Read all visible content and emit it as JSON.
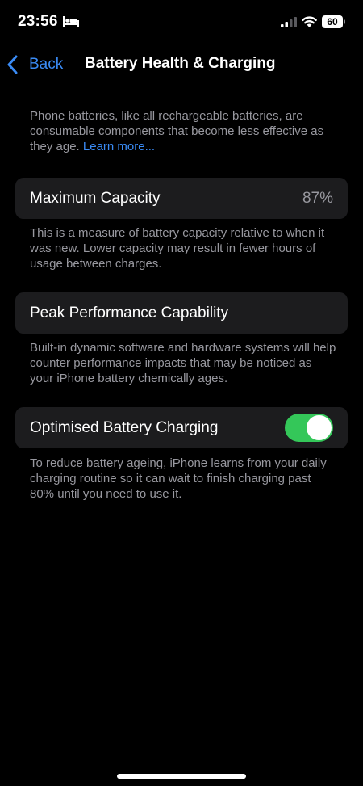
{
  "status_bar": {
    "time": "23:56",
    "sleep_icon": "bed-icon",
    "signal_icon": "cellular-signal-icon",
    "wifi_icon": "wifi-icon",
    "battery_level": "60"
  },
  "nav": {
    "back_label": "Back",
    "title": "Battery Health & Charging"
  },
  "intro": {
    "text": "Phone batteries, like all rechargeable batteries, are consumable components that become less effective as they age.",
    "link": "Learn more..."
  },
  "maximum_capacity": {
    "label": "Maximum Capacity",
    "value": "87%",
    "footer": "This is a measure of battery capacity relative to when it was new. Lower capacity may result in fewer hours of usage between charges."
  },
  "peak_performance": {
    "label": "Peak Performance Capability",
    "footer": "Built-in dynamic software and hardware systems will help counter performance impacts that may be noticed as your iPhone battery chemically ages."
  },
  "optimised_charging": {
    "label": "Optimised Battery Charging",
    "enabled": true,
    "footer": "To reduce battery ageing, iPhone learns from your daily charging routine so it can wait to finish charging past 80% until you need to use it."
  },
  "colors": {
    "accent": "#3a8bf5",
    "toggle_on": "#34c759",
    "cell_background": "#1c1c1e",
    "secondary_text": "#98989f"
  }
}
